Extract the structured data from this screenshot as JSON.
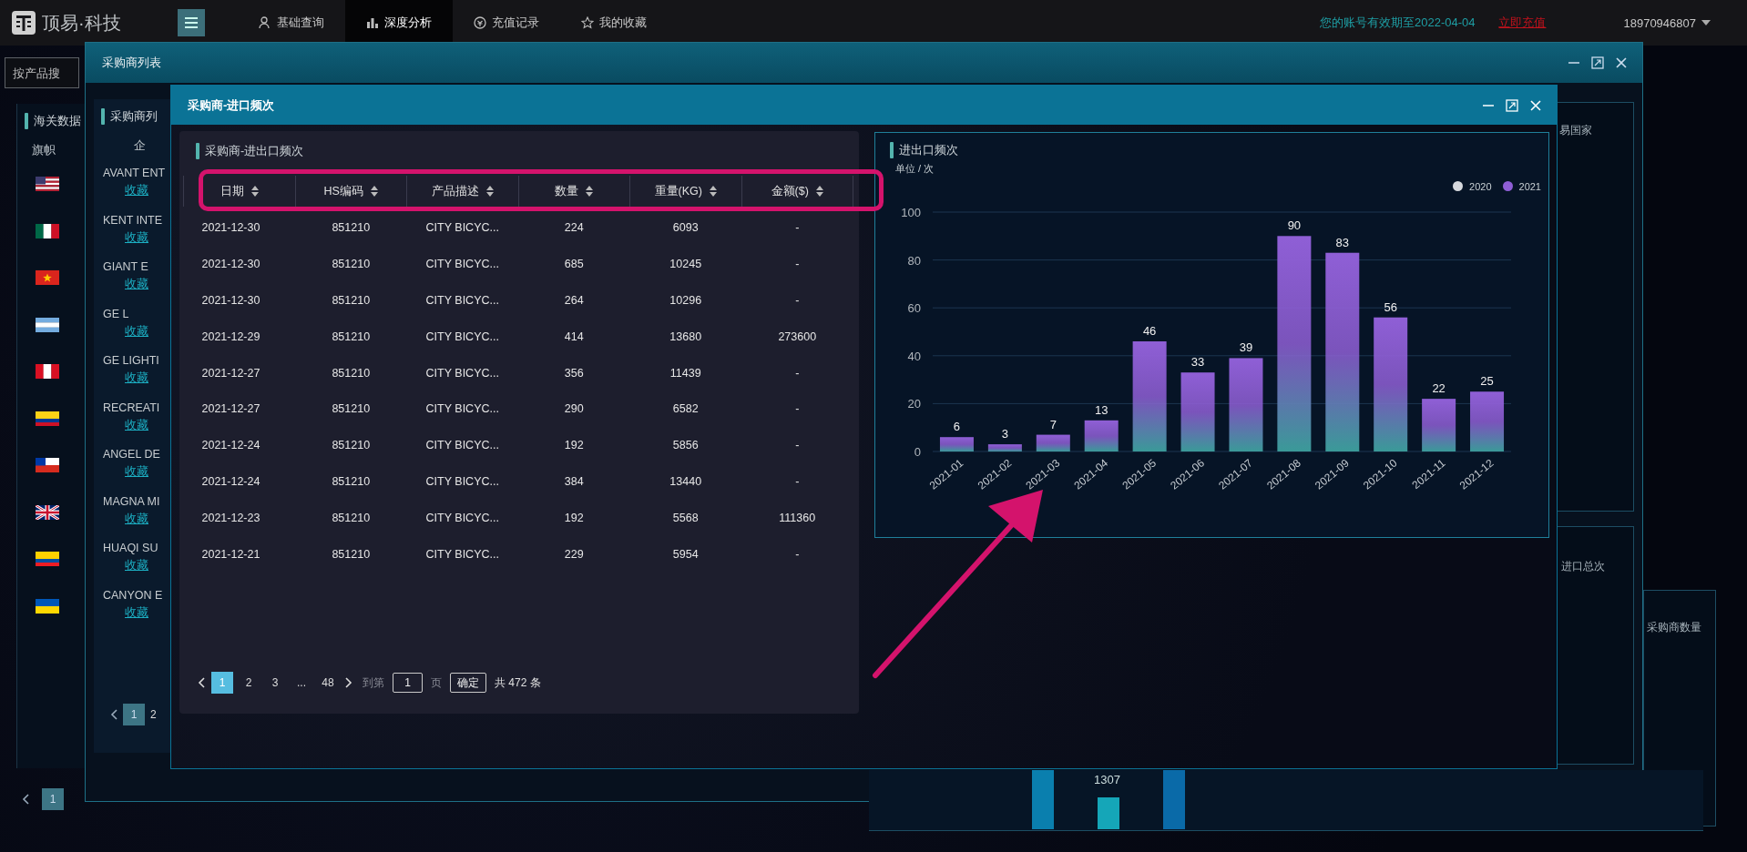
{
  "topbar": {
    "logo": "顶易·科技",
    "nav": [
      {
        "label": "基础查询",
        "kind": "user",
        "selected": false
      },
      {
        "label": "深度分析",
        "kind": "chart",
        "selected": true
      },
      {
        "label": "充值记录",
        "kind": "coin",
        "selected": false
      },
      {
        "label": "我的收藏",
        "kind": "star",
        "selected": false
      }
    ],
    "expiry": "您的账号有效期至2022-04-04",
    "recharge_link": "立即充值",
    "account": "18970946807"
  },
  "background": {
    "search": {
      "placeholder": "按产品搜"
    },
    "customs_panel": {
      "title": "海关数据",
      "column": "旗帜",
      "flags": [
        {
          "kind": "us"
        },
        {
          "kind": "mx"
        },
        {
          "kind": "vn"
        },
        {
          "kind": "ar"
        },
        {
          "kind": "pe"
        },
        {
          "kind": "co"
        },
        {
          "kind": "cl"
        },
        {
          "kind": "gb"
        },
        {
          "kind": "ec"
        },
        {
          "kind": "ua"
        }
      ],
      "pages": [
        {
          "label": "1",
          "selected": true
        }
      ]
    },
    "right_labels": [
      "易国家",
      "进口总次",
      "采购商数量"
    ],
    "bottom_value": "1307"
  },
  "buyer_window": {
    "title": "采购商列表",
    "panel_title": "采购商列",
    "column": "企",
    "rows": [
      {
        "name": "AVANT ENT",
        "link": "收藏"
      },
      {
        "name": "KENT INTE",
        "link": "收藏"
      },
      {
        "name": "GIANT E",
        "link": "收藏"
      },
      {
        "name": "GE L",
        "link": "收藏"
      },
      {
        "name": "GE LIGHTI",
        "link": "收藏"
      },
      {
        "name": "RECREATI",
        "link": "收藏"
      },
      {
        "name": "ANGEL DE",
        "link": "收藏"
      },
      {
        "name": "MAGNA MI",
        "link": "收藏"
      },
      {
        "name": "HUAQI SU",
        "link": "收藏"
      },
      {
        "name": "CANYON E",
        "link": "收藏"
      }
    ],
    "pages": [
      {
        "label": "1",
        "selected": true
      },
      {
        "label": "2",
        "selected": false
      }
    ]
  },
  "frequency_window": {
    "title": "采购商-进口频次",
    "table": {
      "title": "采购商-进出口频次",
      "columns": [
        "日期",
        "HS编码",
        "产品描述",
        "数量",
        "重量(KG)",
        "金额($)"
      ],
      "rows": [
        [
          "2021-12-30",
          "851210",
          "CITY BICYC...",
          "224",
          "6093",
          "-"
        ],
        [
          "2021-12-30",
          "851210",
          "CITY BICYC...",
          "685",
          "10245",
          "-"
        ],
        [
          "2021-12-30",
          "851210",
          "CITY BICYC...",
          "264",
          "10296",
          "-"
        ],
        [
          "2021-12-29",
          "851210",
          "CITY BICYC...",
          "414",
          "13680",
          "273600"
        ],
        [
          "2021-12-27",
          "851210",
          "CITY BICYC...",
          "356",
          "11439",
          "-"
        ],
        [
          "2021-12-27",
          "851210",
          "CITY BICYC...",
          "290",
          "6582",
          "-"
        ],
        [
          "2021-12-24",
          "851210",
          "CITY BICYC...",
          "192",
          "5856",
          "-"
        ],
        [
          "2021-12-24",
          "851210",
          "CITY BICYC...",
          "384",
          "13440",
          "-"
        ],
        [
          "2021-12-23",
          "851210",
          "CITY BICYC...",
          "192",
          "5568",
          "111360"
        ],
        [
          "2021-12-21",
          "851210",
          "CITY BICYC...",
          "229",
          "5954",
          "-"
        ]
      ]
    },
    "pagination": {
      "pages": [
        {
          "label": "1",
          "selected": true
        },
        {
          "label": "2",
          "selected": false
        },
        {
          "label": "3",
          "selected": false
        },
        {
          "label": "...",
          "selected": false
        },
        {
          "label": "48",
          "selected": false
        }
      ],
      "goto_label": "到第",
      "goto_value": "1",
      "page_unit": "页",
      "confirm": "确定",
      "total": "共 472 条"
    },
    "chart": {
      "title": "进出口频次",
      "unit": "单位 / 次",
      "chart_data": {
        "type": "bar",
        "categories": [
          "2021-01",
          "2021-02",
          "2021-03",
          "2021-04",
          "2021-05",
          "2021-06",
          "2021-07",
          "2021-08",
          "2021-09",
          "2021-10",
          "2021-11",
          "2021-12"
        ],
        "series": [
          {
            "name": "2020",
            "color": "#d6d9de",
            "values": [
              null,
              null,
              null,
              null,
              null,
              null,
              null,
              null,
              null,
              null,
              null,
              null
            ]
          },
          {
            "name": "2021",
            "color": "#8f5fd6",
            "values": [
              6,
              3,
              7,
              13,
              46,
              33,
              39,
              90,
              83,
              56,
              22,
              25
            ]
          }
        ],
        "ylim": [
          0,
          100
        ],
        "yticks": [
          0,
          20,
          40,
          60,
          80,
          100
        ],
        "grid": true,
        "data_labels": true
      }
    }
  },
  "annotations": {
    "highlight_header": true,
    "arrow_to_chart": true
  }
}
